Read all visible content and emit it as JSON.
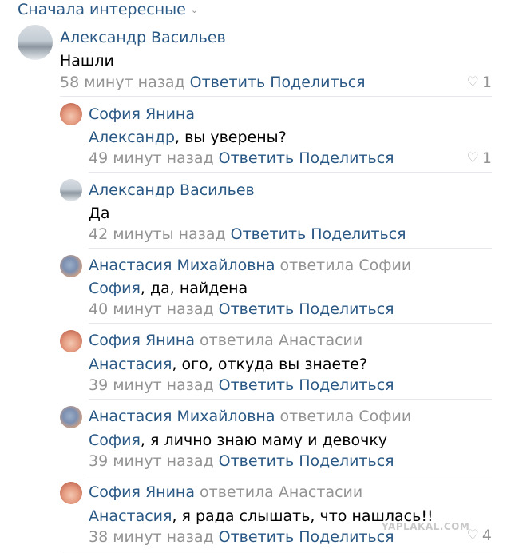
{
  "sort": {
    "label": "Сначала интересные"
  },
  "comments": [
    {
      "author": "Александр Васильев",
      "replied_to": "",
      "mention": "",
      "text": "Нашли",
      "time": "58 минут назад",
      "reply_label": "Ответить",
      "share_label": "Поделиться",
      "likes": "1"
    },
    {
      "author": "София Янина",
      "replied_to": "",
      "mention": "Александр",
      "text": ", вы уверены?",
      "time": "49 минут назад",
      "reply_label": "Ответить",
      "share_label": "Поделиться",
      "likes": "1"
    },
    {
      "author": "Александр Васильев",
      "replied_to": "",
      "mention": "",
      "text": "Да",
      "time": "42 минуты назад",
      "reply_label": "Ответить",
      "share_label": "Поделиться",
      "likes": ""
    },
    {
      "author": "Анастасия Михайловна",
      "replied_to": "ответила Софии",
      "mention": "София",
      "text": ", да, найдена",
      "time": "40 минут назад",
      "reply_label": "Ответить",
      "share_label": "Поделиться",
      "likes": ""
    },
    {
      "author": "София Янина",
      "replied_to": "ответила Анастасии",
      "mention": "Анастасия",
      "text": ", ого, откуда вы знаете?",
      "time": "39 минут назад",
      "reply_label": "Ответить",
      "share_label": "Поделиться",
      "likes": ""
    },
    {
      "author": "Анастасия Михайловна",
      "replied_to": "ответила Софии",
      "mention": "София",
      "text": ", я лично знаю маму и девочку",
      "time": "39 минут назад",
      "reply_label": "Ответить",
      "share_label": "Поделиться",
      "likes": ""
    },
    {
      "author": "София Янина",
      "replied_to": "ответила Анастасии",
      "mention": "Анастасия",
      "text": ", я рада слышать, что нашлась!!",
      "time": "38 минут назад",
      "reply_label": "Ответить",
      "share_label": "Поделиться",
      "likes": "4"
    }
  ],
  "watermark": "YAPLAKAL.COM",
  "icons": {
    "like": "heart-icon",
    "sort": "chevron-down-icon"
  },
  "colors": {
    "link": "#2a5885",
    "muted": "#939393",
    "separator": "#e7e8ec"
  }
}
